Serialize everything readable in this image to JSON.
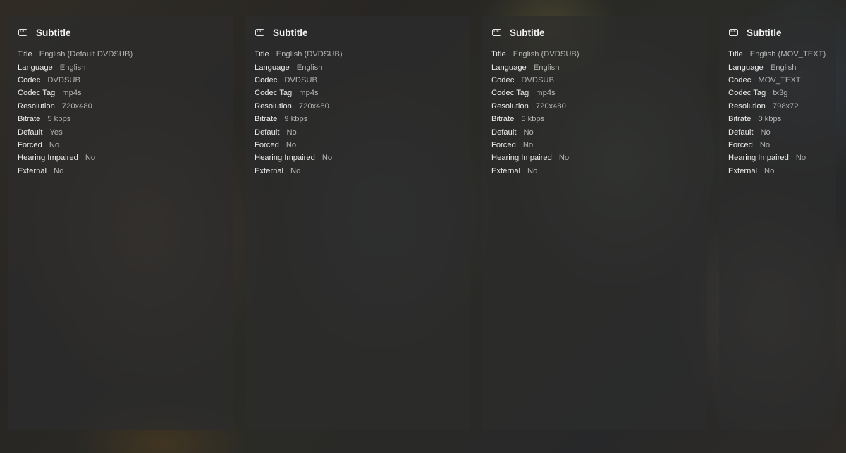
{
  "cards": [
    {
      "icon": "closed-captions-icon",
      "title": "Subtitle",
      "props": [
        {
          "label": "Title",
          "value": "English (Default DVDSUB)"
        },
        {
          "label": "Language",
          "value": "English"
        },
        {
          "label": "Codec",
          "value": "DVDSUB"
        },
        {
          "label": "Codec Tag",
          "value": "mp4s"
        },
        {
          "label": "Resolution",
          "value": "720x480"
        },
        {
          "label": "Bitrate",
          "value": "5 kbps"
        },
        {
          "label": "Default",
          "value": "Yes"
        },
        {
          "label": "Forced",
          "value": "No"
        },
        {
          "label": "Hearing Impaired",
          "value": "No"
        },
        {
          "label": "External",
          "value": "No"
        }
      ]
    },
    {
      "icon": "closed-captions-icon",
      "title": "Subtitle",
      "props": [
        {
          "label": "Title",
          "value": "English (DVDSUB)"
        },
        {
          "label": "Language",
          "value": "English"
        },
        {
          "label": "Codec",
          "value": "DVDSUB"
        },
        {
          "label": "Codec Tag",
          "value": "mp4s"
        },
        {
          "label": "Resolution",
          "value": "720x480"
        },
        {
          "label": "Bitrate",
          "value": "9 kbps"
        },
        {
          "label": "Default",
          "value": "No"
        },
        {
          "label": "Forced",
          "value": "No"
        },
        {
          "label": "Hearing Impaired",
          "value": "No"
        },
        {
          "label": "External",
          "value": "No"
        }
      ]
    },
    {
      "icon": "closed-captions-icon",
      "title": "Subtitle",
      "props": [
        {
          "label": "Title",
          "value": "English (DVDSUB)"
        },
        {
          "label": "Language",
          "value": "English"
        },
        {
          "label": "Codec",
          "value": "DVDSUB"
        },
        {
          "label": "Codec Tag",
          "value": "mp4s"
        },
        {
          "label": "Resolution",
          "value": "720x480"
        },
        {
          "label": "Bitrate",
          "value": "5 kbps"
        },
        {
          "label": "Default",
          "value": "No"
        },
        {
          "label": "Forced",
          "value": "No"
        },
        {
          "label": "Hearing Impaired",
          "value": "No"
        },
        {
          "label": "External",
          "value": "No"
        }
      ]
    },
    {
      "icon": "closed-captions-icon",
      "title": "Subtitle",
      "props": [
        {
          "label": "Title",
          "value": "English (MOV_TEXT)"
        },
        {
          "label": "Language",
          "value": "English"
        },
        {
          "label": "Codec",
          "value": "MOV_TEXT"
        },
        {
          "label": "Codec Tag",
          "value": "tx3g"
        },
        {
          "label": "Resolution",
          "value": "798x72"
        },
        {
          "label": "Bitrate",
          "value": "0 kbps"
        },
        {
          "label": "Default",
          "value": "No"
        },
        {
          "label": "Forced",
          "value": "No"
        },
        {
          "label": "Hearing Impaired",
          "value": "No"
        },
        {
          "label": "External",
          "value": "No"
        }
      ]
    }
  ]
}
